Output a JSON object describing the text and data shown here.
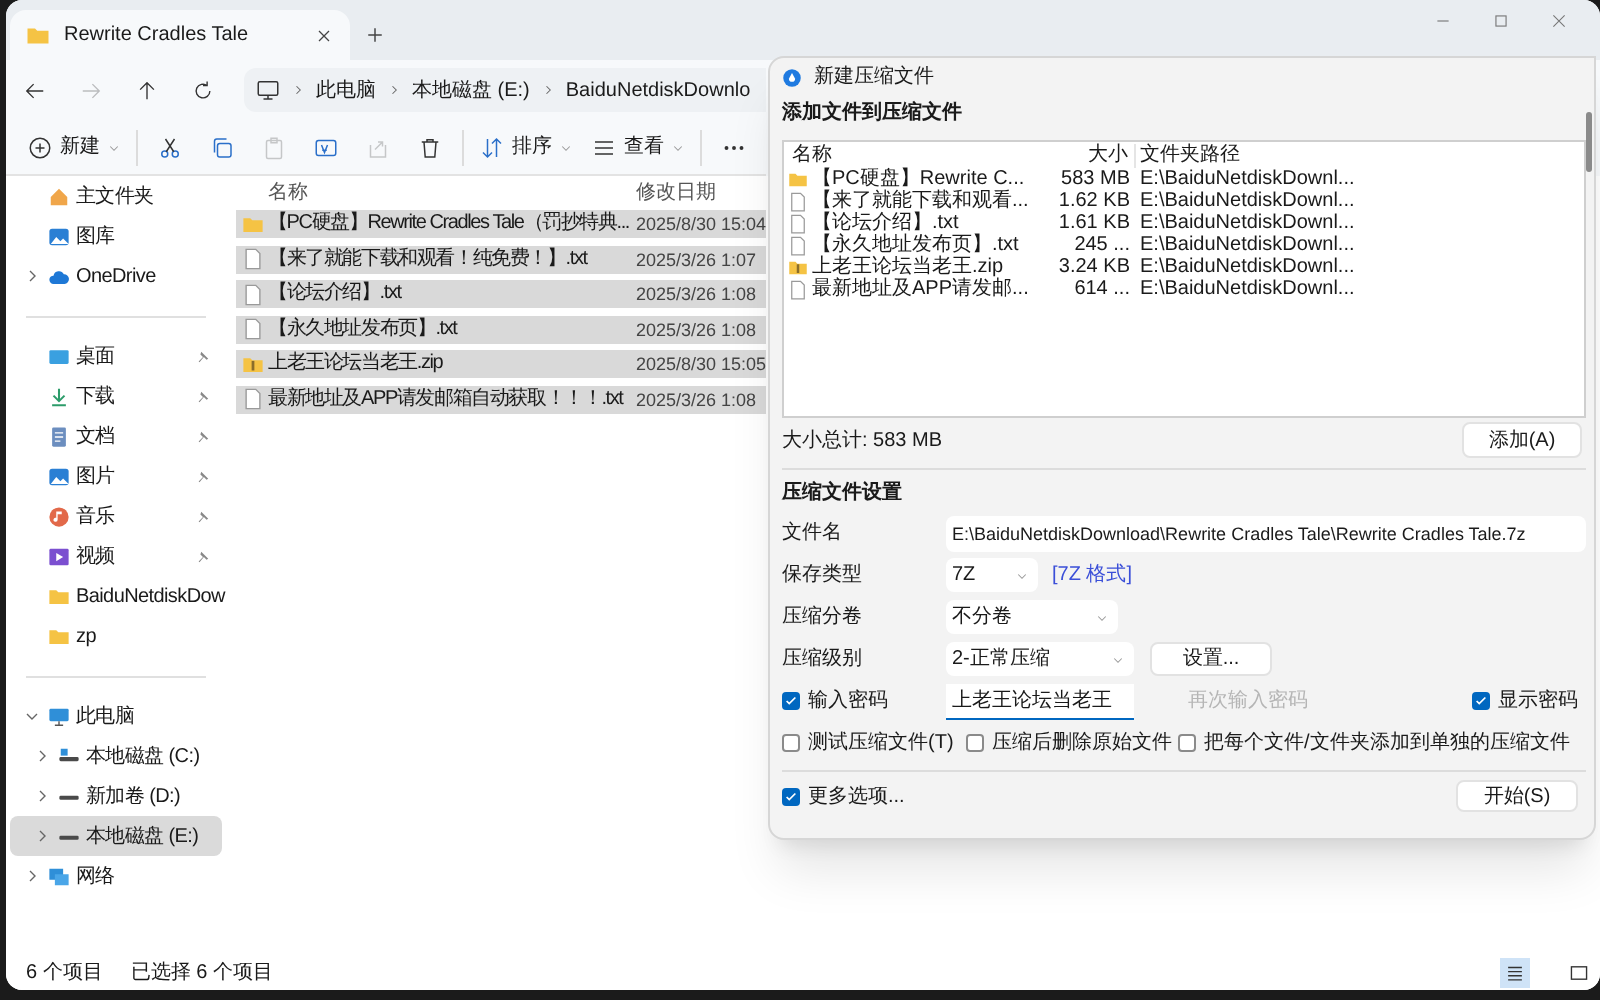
{
  "explorer": {
    "tabs": [
      {
        "title": "Rewrite Cradles Tale",
        "selected": true
      }
    ],
    "nav": [
      {
        "kind": "back",
        "disabled": false
      },
      {
        "kind": "forward",
        "disabled": true
      },
      {
        "kind": "up",
        "disabled": false
      },
      {
        "kind": "refresh",
        "disabled": false
      }
    ],
    "breadcrumb": [
      "此电脑",
      "本地磁盘 (E:)",
      "BaiduNetdiskDownlo"
    ],
    "toolbar": [
      {
        "kind": "new",
        "label": "新建",
        "disabled": false
      },
      {
        "kind": "cut",
        "disabled": false
      },
      {
        "kind": "copy",
        "disabled": false
      },
      {
        "kind": "paste",
        "disabled": true
      },
      {
        "kind": "rename",
        "disabled": false
      },
      {
        "kind": "share",
        "disabled": true
      },
      {
        "kind": "delete",
        "disabled": false
      },
      {
        "kind": "sort",
        "label": "排序",
        "disabled": false
      },
      {
        "kind": "view",
        "label": "查看",
        "disabled": false
      },
      {
        "kind": "more",
        "disabled": false
      }
    ],
    "sidebar": {
      "top": [
        {
          "kind": "home",
          "label": "主文件夹",
          "selected": false
        },
        {
          "kind": "gallery",
          "label": "图库",
          "selected": false
        },
        {
          "kind": "cloud",
          "label": "OneDrive",
          "expanded": false,
          "selected": false
        }
      ],
      "quick": [
        {
          "kind": "desktop",
          "label": "桌面",
          "pinned": true,
          "selected": false
        },
        {
          "kind": "download",
          "label": "下载",
          "pinned": true,
          "selected": false
        },
        {
          "kind": "document",
          "label": "文档",
          "pinned": true,
          "selected": false
        },
        {
          "kind": "gallery",
          "label": "图片",
          "pinned": true,
          "selected": false
        },
        {
          "kind": "music",
          "label": "音乐",
          "pinned": true,
          "selected": false
        },
        {
          "kind": "video",
          "label": "视频",
          "pinned": true,
          "selected": false
        },
        {
          "kind": "folder",
          "label": "BaiduNetdiskDow",
          "pinned": false,
          "selected": false
        },
        {
          "kind": "folder",
          "label": "zp",
          "pinned": false,
          "selected": false
        }
      ],
      "tree": [
        {
          "kind": "pc",
          "label": "此电脑",
          "expanded": true,
          "selected": false,
          "children": [
            {
              "kind": "system-drive",
              "label": "本地磁盘 (C:)",
              "expanded": false,
              "selected": false
            },
            {
              "kind": "drive",
              "label": "新加卷 (D:)",
              "expanded": false,
              "selected": false
            },
            {
              "kind": "drive",
              "label": "本地磁盘 (E:)",
              "expanded": false,
              "selected": true
            }
          ]
        },
        {
          "kind": "network",
          "label": "网络",
          "expanded": false,
          "selected": false
        }
      ]
    },
    "columns": [
      "名称",
      "修改日期"
    ],
    "files": [
      {
        "kind": "folder",
        "name": "【PC硬盘】Rewrite Cradles Tale（罚抄特典...",
        "modified": "2025/8/30 15:04",
        "selected": true
      },
      {
        "kind": "file",
        "name": "【来了就能下载和观看！纯免费！】.txt",
        "modified": "2025/3/26 1:07",
        "selected": true
      },
      {
        "kind": "file",
        "name": "【论坛介绍】.txt",
        "modified": "2025/3/26 1:08",
        "selected": true
      },
      {
        "kind": "file",
        "name": "【永久地址发布页】.txt",
        "modified": "2025/3/26 1:08",
        "selected": true
      },
      {
        "kind": "zip",
        "name": "上老王论坛当老王.zip",
        "modified": "2025/8/30 15:05",
        "selected": true
      },
      {
        "kind": "file",
        "name": "最新地址及APP请发邮箱自动获取！！！.txt",
        "modified": "2025/3/26 1:08",
        "selected": true
      }
    ],
    "status": {
      "count": "6 个项目",
      "selection": "已选择 6 个项目"
    },
    "views": [
      {
        "kind": "details",
        "selected": true
      },
      {
        "kind": "tiles",
        "selected": false
      }
    ]
  },
  "dialog": {
    "title": "新建压缩文件",
    "add_section": "添加文件到压缩文件",
    "list": {
      "columns": [
        "名称",
        "大小",
        "文件夹路径"
      ],
      "rows": [
        {
          "kind": "folder",
          "name": "【PC硬盘】Rewrite C...",
          "size": "583 MB",
          "path": "E:\\BaiduNetdiskDownl..."
        },
        {
          "kind": "file",
          "name": "【来了就能下载和观看...",
          "size": "1.62 KB",
          "path": "E:\\BaiduNetdiskDownl..."
        },
        {
          "kind": "file",
          "name": "【论坛介绍】.txt",
          "size": "1.61 KB",
          "path": "E:\\BaiduNetdiskDownl..."
        },
        {
          "kind": "file",
          "name": "【永久地址发布页】.txt",
          "size": "245 ...",
          "path": "E:\\BaiduNetdiskDownl..."
        },
        {
          "kind": "zip",
          "name": "上老王论坛当老王.zip",
          "size": "3.24 KB",
          "path": "E:\\BaiduNetdiskDownl..."
        },
        {
          "kind": "file",
          "name": "最新地址及APP请发邮...",
          "size": "614 ...",
          "path": "E:\\BaiduNetdiskDownl..."
        }
      ]
    },
    "total": "大小总计: 583 MB",
    "add_button": "添加(A)",
    "settings_title": "压缩文件设置",
    "filename": {
      "label": "文件名",
      "value": "E:\\BaiduNetdiskDownload\\Rewrite Cradles Tale\\Rewrite Cradles Tale.7z"
    },
    "format": {
      "label": "保存类型",
      "value": "7Z",
      "note": "[7Z 格式]"
    },
    "split": {
      "label": "压缩分卷",
      "value": "不分卷"
    },
    "level": {
      "label": "压缩级别",
      "value": "2-正常压缩",
      "button": "设置..."
    },
    "password": {
      "label": "输入密码",
      "checked": true,
      "value": "上老王论坛当老王"
    },
    "confirm": {
      "placeholder": "再次输入密码",
      "disabled": true
    },
    "show_password": {
      "label": "显示密码",
      "checked": true
    },
    "options": [
      {
        "label": "测试压缩文件(T)",
        "checked": false
      },
      {
        "label": "压缩后删除原始文件",
        "checked": false
      },
      {
        "label": "把每个文件/文件夹添加到单独的压缩文件",
        "checked": false
      }
    ],
    "more": {
      "label": "更多选项...",
      "checked": true
    },
    "start_button": "开始(S)"
  }
}
